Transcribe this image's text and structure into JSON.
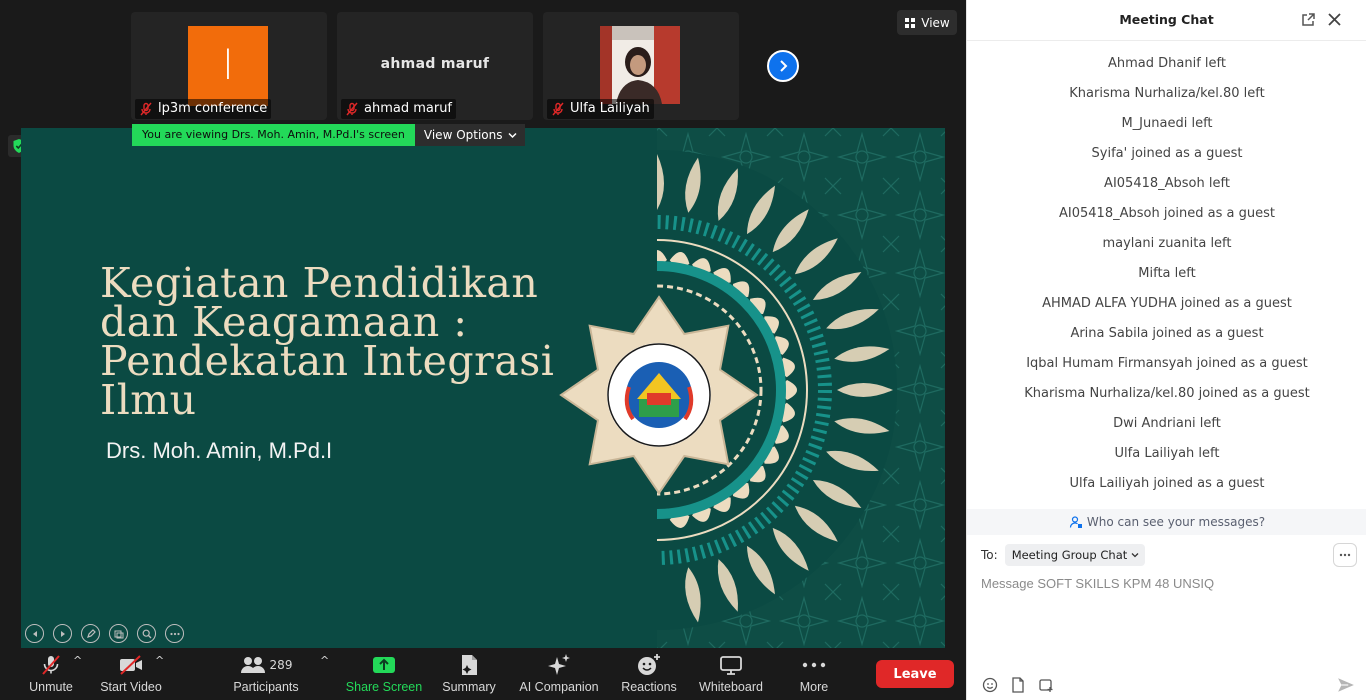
{
  "video_strip": {
    "tiles": [
      {
        "name": "lp3m conference",
        "avatar_letter": "l",
        "avatar_color": "#f26c0b"
      },
      {
        "name": "ahmad maruf",
        "display_name": "ahmad maruf"
      },
      {
        "name": "Ulfa Lailiyah"
      }
    ],
    "view_label": "View"
  },
  "share_banner": {
    "viewing_text": "You are viewing Drs. Moh. Amin, M.Pd.I's screen",
    "view_options_label": "View Options"
  },
  "slide": {
    "title_lines": [
      "Kegiatan Pendidikan",
      "dan Keagamaan :",
      "Pendekatan Integrasi",
      "Ilmu"
    ],
    "presenter": "Drs. Moh. Amin, M.Pd.I",
    "background_color": "#0b4a43",
    "ornament_color": "#ecdcc0",
    "accent_color": "#17928a"
  },
  "toolbar": {
    "unmute": "Unmute",
    "start_video": "Start Video",
    "participants": "Participants",
    "participants_count": "289",
    "share_screen": "Share Screen",
    "summary": "Summary",
    "ai_companion": "AI Companion",
    "reactions": "Reactions",
    "whiteboard": "Whiteboard",
    "more": "More",
    "leave": "Leave",
    "leave_color": "#e02828",
    "share_color": "#23d959"
  },
  "chat": {
    "title": "Meeting Chat",
    "messages": [
      "Ahmad Dhanif left",
      "Kharisma Nurhaliza/kel.80 left",
      "M_Junaedi left",
      "Syifa' joined as a guest",
      "AI05418_Absoh left",
      "AI05418_Absoh joined as a guest",
      "maylani zuanita left",
      "Mifta left",
      "AHMAD ALFA YUDHA joined as a guest",
      "Arina Sabila joined as a guest",
      "Iqbal Humam Firmansyah joined as a guest",
      "Kharisma Nurhaliza/kel.80 joined as a guest",
      "Dwi Andriani left",
      "Ulfa Lailiyah left",
      "Ulfa Lailiyah joined as a guest"
    ],
    "who_can_see": "Who can see your messages?",
    "to_label": "To:",
    "to_value": "Meeting Group Chat",
    "input_placeholder": "Message SOFT SKILLS KPM 48 UNSIQ"
  }
}
